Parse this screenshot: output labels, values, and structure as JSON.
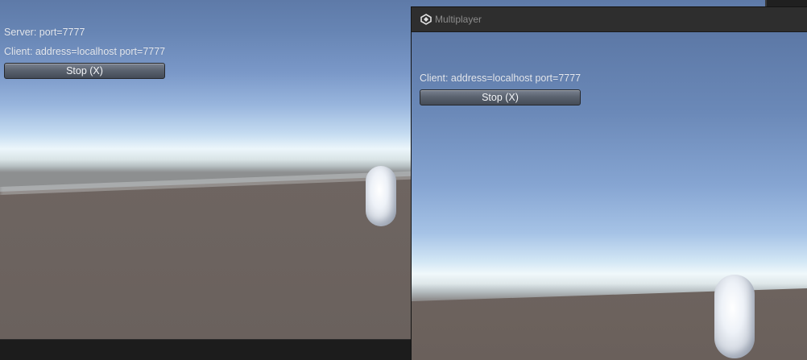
{
  "main_view": {
    "server_label": "Server: port=7777",
    "client_label": "Client: address=localhost port=7777",
    "stop_button_label": "Stop (X)"
  },
  "multiplayer_window": {
    "title": "Multiplayer",
    "title_icon": "unity-logo-icon",
    "client_label": "Client: address=localhost port=7777",
    "stop_button_label": "Stop (X)"
  },
  "colors": {
    "sky_top": "#5e7aa8",
    "horizon": "#ecf6fb",
    "ground": "#6f6662",
    "button": "#5b6370",
    "window_chrome": "#2e2e2e",
    "overlay_text": "#e4e8ef"
  }
}
